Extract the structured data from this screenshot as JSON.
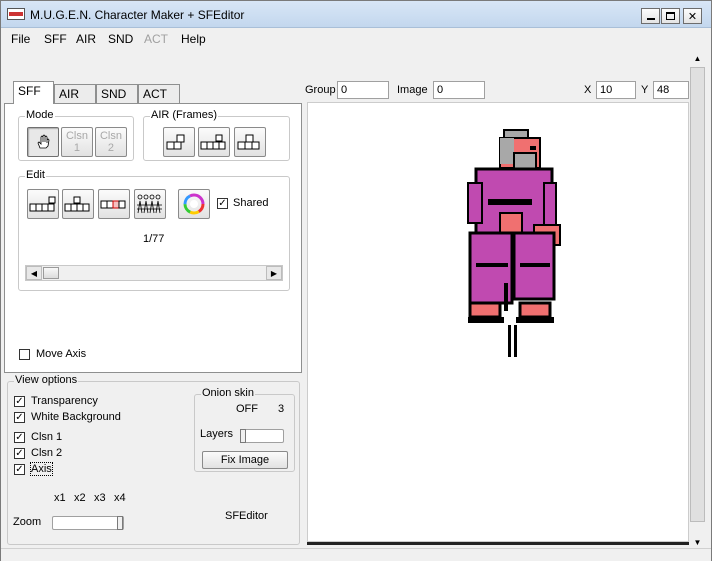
{
  "window": {
    "title": "M.U.G.E.N. Character Maker + SFEditor"
  },
  "menu": {
    "items": [
      "File",
      "SFF",
      "AIR",
      "SND",
      "ACT",
      "Help"
    ]
  },
  "tabs": [
    "SFF",
    "AIR",
    "SND",
    "ACT"
  ],
  "mode": {
    "label": "Mode",
    "clsn1": "Clsn\n1",
    "clsn2": "Clsn\n2"
  },
  "air_frames": {
    "label": "AIR (Frames)"
  },
  "edit": {
    "label": "Edit",
    "shared_label": "Shared",
    "shared_checked": true,
    "frame_counter": "1/77"
  },
  "move_axis": {
    "label": "Move Axis",
    "checked": false
  },
  "view_options": {
    "label": "View options",
    "transparency": "Transparency",
    "white_background": "White Background",
    "clsn1": "Clsn 1",
    "clsn2": "Clsn 2",
    "axis": "Axis"
  },
  "onion_skin": {
    "label": "Onion skin",
    "off_label": "OFF",
    "max_label": "3",
    "layers_label": "Layers",
    "fix_image_button": "Fix Image"
  },
  "zoom": {
    "label": "Zoom",
    "ticks": [
      "x1",
      "x2",
      "x3",
      "x4"
    ],
    "value": "x4"
  },
  "sfeditor_label": "SFEditor",
  "top_fields": {
    "group_label": "Group",
    "group_value": "0",
    "image_label": "Image",
    "image_value": "0",
    "x_label": "X",
    "x_value": "10",
    "y_label": "Y",
    "y_value": "48"
  },
  "colors": {
    "sprite_purple": "#c04ab0",
    "sprite_skin": "#f07070",
    "sprite_outline": "#000000",
    "sprite_gray": "#a8a8a8"
  }
}
